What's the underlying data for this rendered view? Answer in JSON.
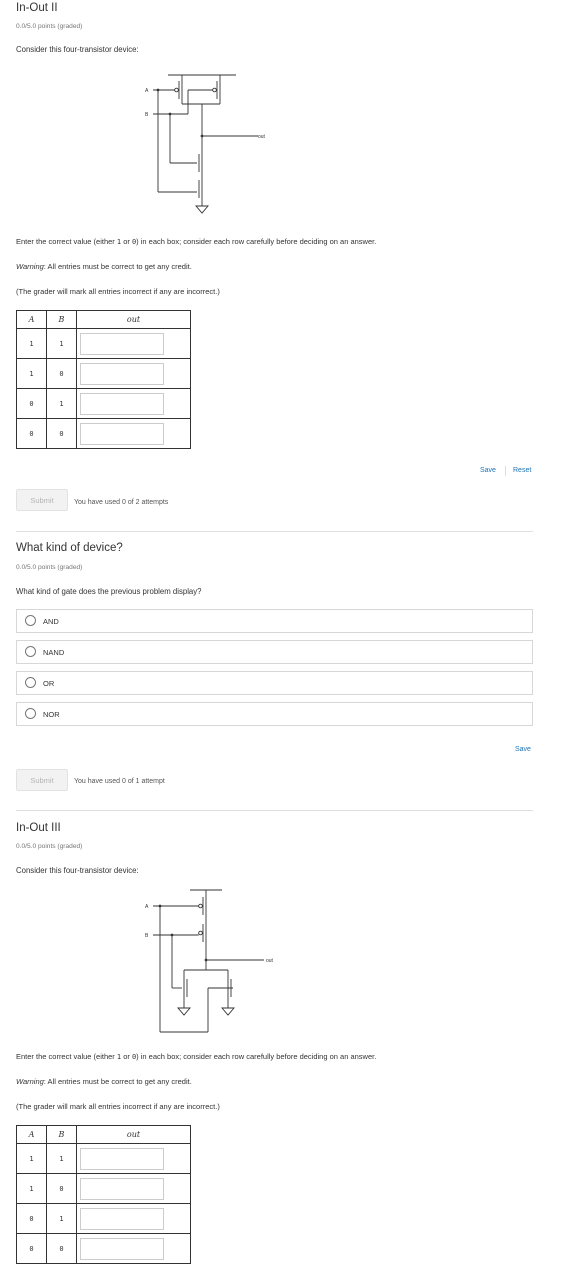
{
  "problem1": {
    "title": "In-Out II",
    "points": "0.0/5.0 points (graded)",
    "prompt": "Consider this four-transistor device:",
    "diagram_labels": {
      "a": "A",
      "b": "B",
      "out": "out"
    },
    "instruction_pre": "Enter the correct value (either ",
    "instruction_one": "1",
    "instruction_or": " or ",
    "instruction_zero": "0",
    "instruction_post": ") in each box; consider each row carefully before deciding on an answer.",
    "warning_label": "Warning",
    "warning_text": ": All entries must be correct to get any credit.",
    "grader_note": "(The grader will mark all entries incorrect if any are incorrect.)",
    "table": {
      "headers": [
        "A",
        "B",
        "out"
      ],
      "rows": [
        {
          "a": "1",
          "b": "1",
          "out": ""
        },
        {
          "a": "1",
          "b": "0",
          "out": ""
        },
        {
          "a": "0",
          "b": "1",
          "out": ""
        },
        {
          "a": "0",
          "b": "0",
          "out": ""
        }
      ]
    },
    "save_label": "Save",
    "reset_label": "Reset",
    "submit_label": "Submit",
    "attempts_text": "You have used 0 of 2 attempts"
  },
  "problem2": {
    "title": "What kind of device?",
    "points": "0.0/5.0 points (graded)",
    "prompt": "What kind of gate does the previous problem display?",
    "options": [
      "AND",
      "NAND",
      "OR",
      "NOR"
    ],
    "save_label": "Save",
    "submit_label": "Submit",
    "attempts_text": "You have used 0 of 1 attempt"
  },
  "problem3": {
    "title": "In-Out III",
    "points": "0.0/5.0 points (graded)",
    "prompt": "Consider this four-transistor device:",
    "diagram_labels": {
      "a": "A",
      "b": "B",
      "out": "out"
    },
    "instruction_pre": "Enter the correct value (either ",
    "instruction_one": "1",
    "instruction_or": " or ",
    "instruction_zero": "0",
    "instruction_post": ") in each box; consider each row carefully before deciding on an answer.",
    "warning_label": "Warning",
    "warning_text": ": All entries must be correct to get any credit.",
    "grader_note": "(The grader will mark all entries incorrect if any are incorrect.)",
    "table": {
      "headers": [
        "A",
        "B",
        "out"
      ],
      "rows": [
        {
          "a": "1",
          "b": "1",
          "out": ""
        },
        {
          "a": "1",
          "b": "0",
          "out": ""
        },
        {
          "a": "0",
          "b": "1",
          "out": ""
        },
        {
          "a": "0",
          "b": "0",
          "out": ""
        }
      ]
    }
  }
}
